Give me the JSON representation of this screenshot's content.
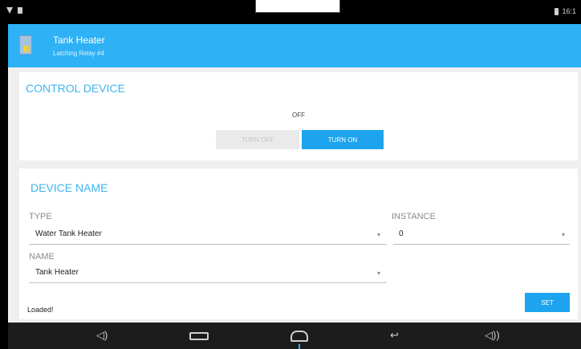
{
  "header": {
    "title": "Tank Heater",
    "subtitle": "Latching Relay #4"
  },
  "control": {
    "heading": "CONTROL DEVICE",
    "state": "OFF",
    "turn_off_label": "TURN OFF",
    "turn_on_label": "TURN ON"
  },
  "device_name": {
    "heading": "DEVICE NAME",
    "type_label": "TYPE",
    "type_value": "Water Tank Heater",
    "instance_label": "INSTANCE",
    "instance_value": "0",
    "name_label": "NAME",
    "name_value": "Tank Heater",
    "status": "Loaded!",
    "set_label": "SET"
  },
  "status_bar": {
    "time": "16:1"
  },
  "colors": {
    "accent": "#2fb1f5",
    "button": "#1ea4ee",
    "heading": "#3fb5ee"
  },
  "icons": {
    "app": "relay-device-icon",
    "dropdown": "triangle-down"
  }
}
